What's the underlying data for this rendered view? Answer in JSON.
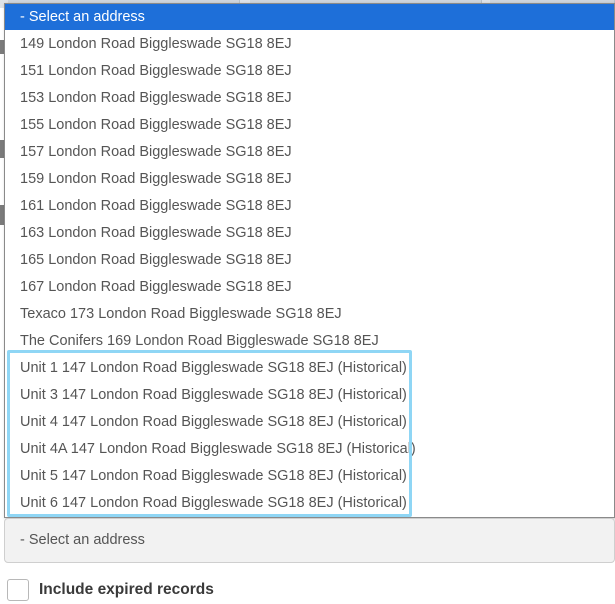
{
  "dropdown": {
    "selected_label": "- Select an address",
    "options": [
      "149 London Road Biggleswade SG18 8EJ",
      "151 London Road Biggleswade SG18 8EJ",
      "153 London Road Biggleswade SG18 8EJ",
      "155 London Road Biggleswade SG18 8EJ",
      "157 London Road Biggleswade SG18 8EJ",
      "159 London Road Biggleswade SG18 8EJ",
      "161 London Road Biggleswade SG18 8EJ",
      "163 London Road Biggleswade SG18 8EJ",
      "165 London Road Biggleswade SG18 8EJ",
      "167 London Road Biggleswade SG18 8EJ",
      "Texaco 173 London Road Biggleswade SG18 8EJ",
      "The Conifers 169 London Road Biggleswade SG18 8EJ",
      "Unit 1 147 London Road Biggleswade SG18 8EJ (Historical)",
      "Unit 3 147 London Road Biggleswade SG18 8EJ (Historical)",
      "Unit 4 147 London Road Biggleswade SG18 8EJ (Historical)",
      "Unit 4A 147 London Road Biggleswade SG18 8EJ (Historical)",
      "Unit 5 147 London Road Biggleswade SG18 8EJ (Historical)",
      "Unit 6 147 London Road Biggleswade SG18 8EJ (Historical)"
    ]
  },
  "select": {
    "value": "- Select an address"
  },
  "expired": {
    "label": "Include expired records",
    "checked": false
  },
  "colors": {
    "selected_bg": "#1e6fd9",
    "highlight_border": "#8fd6f5",
    "option_text": "#555555"
  }
}
